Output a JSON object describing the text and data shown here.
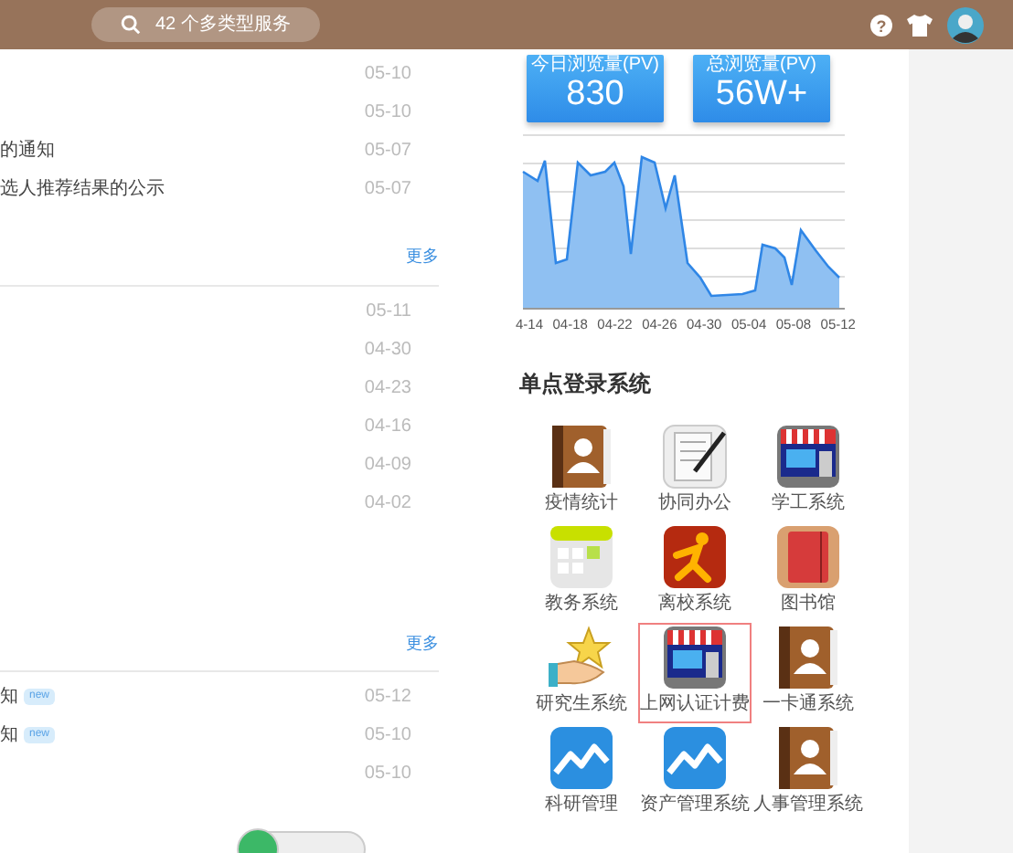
{
  "header": {
    "search_placeholder": "42 个多类型服务",
    "help_glyph": "?"
  },
  "news_sections": [
    {
      "items": [
        {
          "date": "05-10"
        },
        {
          "date": "05-10"
        },
        {
          "title": "的通知",
          "date": "05-07"
        },
        {
          "title": "选人推荐结果的公示",
          "date": "05-07"
        }
      ],
      "more": "更多"
    },
    {
      "items": [
        {
          "date": "05-11"
        },
        {
          "date": "04-30"
        },
        {
          "date": "04-23"
        },
        {
          "date": "04-16"
        },
        {
          "date": "04-09"
        },
        {
          "date": "04-02"
        }
      ],
      "more": "更多"
    },
    {
      "items": [
        {
          "title": "知",
          "badge": "new",
          "date": "05-12"
        },
        {
          "title": "知",
          "badge": "new",
          "date": "05-10"
        },
        {
          "date": "05-10"
        }
      ]
    }
  ],
  "stats": [
    {
      "label": "今日浏览量(PV)",
      "value": "830"
    },
    {
      "label": "总浏览量(PV)",
      "value": "56W+"
    }
  ],
  "traffic_chart": {
    "axis_labels": [
      "4-14",
      "04-18",
      "04-22",
      "04-26",
      "04-30",
      "05-04",
      "05-08",
      "05-12"
    ]
  },
  "sso": {
    "title": "单点登录系统",
    "apps": [
      {
        "label": "疫情统计",
        "kind": "contacts",
        "selected": false
      },
      {
        "label": "协同办公",
        "kind": "document",
        "selected": false
      },
      {
        "label": "学工系统",
        "kind": "store",
        "selected": false
      },
      {
        "label": "教务系统",
        "kind": "calendar",
        "selected": false
      },
      {
        "label": "离校系统",
        "kind": "runner",
        "selected": false
      },
      {
        "label": "图书馆",
        "kind": "book",
        "selected": false
      },
      {
        "label": "研究生系统",
        "kind": "star",
        "selected": false
      },
      {
        "label": "上网认证计费",
        "kind": "store",
        "selected": true
      },
      {
        "label": "一卡通系统",
        "kind": "contacts",
        "selected": false
      },
      {
        "label": "科研管理",
        "kind": "chart",
        "selected": false
      },
      {
        "label": "资产管理系统",
        "kind": "chart",
        "selected": false
      },
      {
        "label": "人事管理系统",
        "kind": "contacts",
        "selected": false
      }
    ]
  }
}
